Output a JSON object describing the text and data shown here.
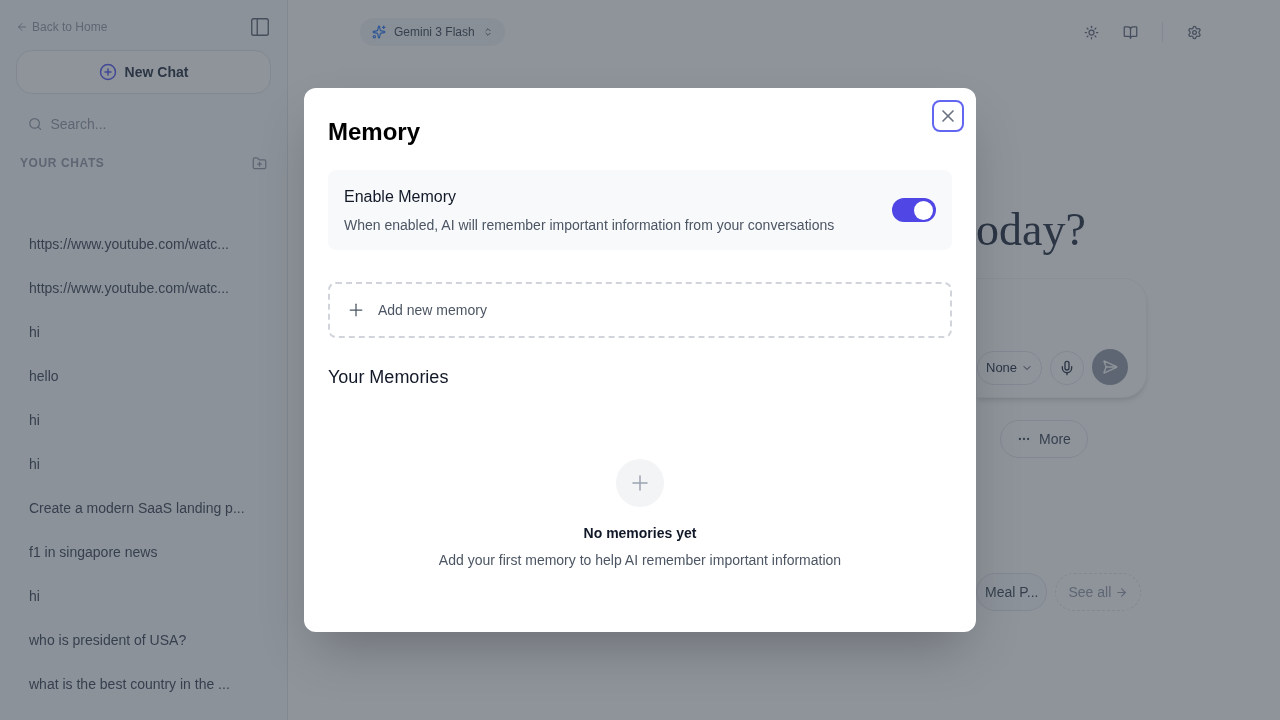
{
  "sidebar": {
    "back_link": "Back to Home",
    "new_chat": "New Chat",
    "search": {
      "placeholder": "Search..."
    },
    "section_title": "YOUR CHATS",
    "chats": [
      {
        "title": "https://www.youtube.com/watc..."
      },
      {
        "title": "https://www.youtube.com/watc..."
      },
      {
        "title": "hi"
      },
      {
        "title": "hello"
      },
      {
        "title": "hi"
      },
      {
        "title": "hi"
      },
      {
        "title": "Create a modern SaaS landing p..."
      },
      {
        "title": "f1 in singapore news"
      },
      {
        "title": "hi"
      },
      {
        "title": "who is president of USA?"
      },
      {
        "title": "what is the best country in the ..."
      }
    ]
  },
  "header": {
    "model": "Gemini 3 Flash"
  },
  "main": {
    "heading": "oday?",
    "composer": {
      "style_select": "None"
    },
    "quick_actions": [
      "More"
    ],
    "suggestions": [
      "Meal P..."
    ],
    "see_all": "See all"
  },
  "modal": {
    "title": "Memory",
    "setting": {
      "label": "Enable Memory",
      "description": "When enabled, AI will remember important information from your conversations",
      "on": true
    },
    "add_label": "Add new memory",
    "section_title": "Your Memories",
    "empty": {
      "title": "No memories yet",
      "text": "Add your first memory to help AI remember important information"
    }
  }
}
